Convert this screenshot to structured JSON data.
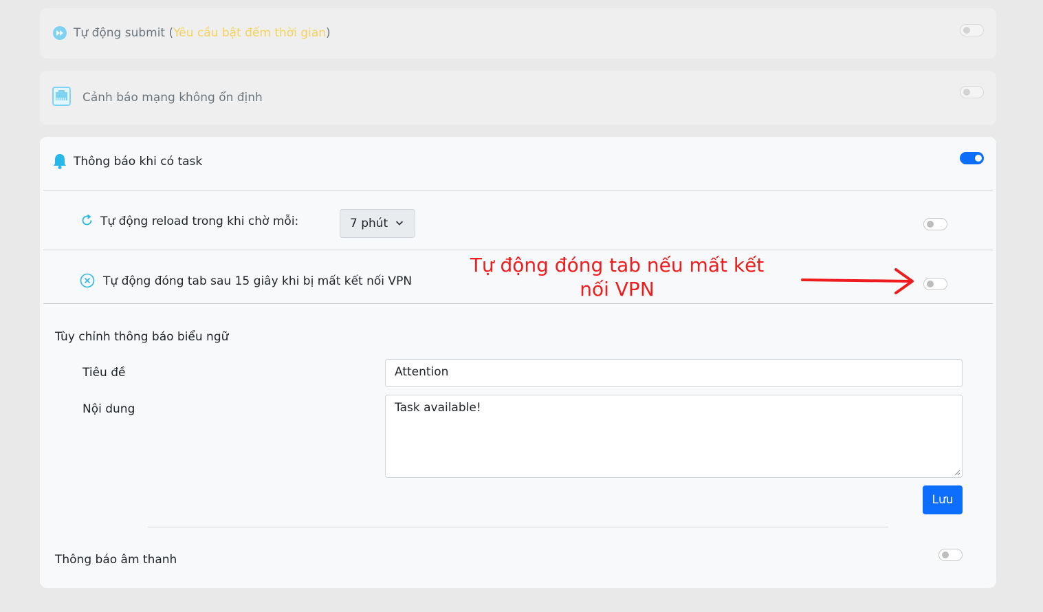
{
  "auto_submit": {
    "label": "Tự động submit (",
    "hint": "Yêu cầu bật đếm thời gian",
    "close_paren": ")",
    "enabled": false,
    "icon": "fast-forward-icon"
  },
  "network_warning": {
    "label": "Cảnh báo mạng không ổn định",
    "enabled": false,
    "icon": "network-icon"
  },
  "task_notification": {
    "label": "Thông báo khi có task",
    "enabled": true,
    "icon": "bell-icon",
    "auto_reload": {
      "label": "Tự động reload trong khi chờ mỗi:",
      "interval_selected": "7 phút",
      "enabled": false,
      "icon": "refresh-icon"
    },
    "auto_close_tab": {
      "label": "Tự động đóng tab sau 15 giây khi bị mất kết nối VPN",
      "enabled": false,
      "icon": "close-circle-icon"
    },
    "banner": {
      "section_title": "Tùy chỉnh thông báo biểu ngữ",
      "title_label": "Tiêu đề",
      "title_value": "Attention",
      "content_label": "Nội dung",
      "content_value": "Task available!",
      "save_label": "Lưu"
    },
    "sound": {
      "label": "Thông báo âm thanh",
      "enabled": false
    }
  },
  "annotation": {
    "text": "Tự động đóng tab nếu mất kết nối VPN",
    "color": "#ee1c1c"
  },
  "colors": {
    "primary": "#0d6efd",
    "accent_icon": "#29b6e8",
    "warning_text": "#f3d25f",
    "page_bg": "#e9e9e9"
  }
}
